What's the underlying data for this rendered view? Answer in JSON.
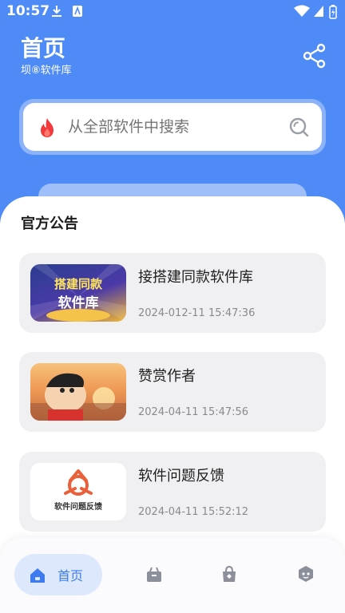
{
  "status_bar": {
    "time": "10:57"
  },
  "header": {
    "title": "首页",
    "subtitle": "坝⑧软件库"
  },
  "search": {
    "placeholder": "从全部软件中搜索"
  },
  "announcements": {
    "title": "官方公告",
    "items": [
      {
        "title": "接搭建同款软件库",
        "time": "2024-012-11 15:47:36",
        "thumb_text_1": "搭建同款",
        "thumb_text_2": "软件库"
      },
      {
        "title": "赞赏作者",
        "time": "2024-04-11 15:47:56"
      },
      {
        "title": "软件问题反馈",
        "time": "2024-04-11 15:52:12",
        "thumb_text": "软件问题反馈"
      }
    ]
  },
  "bottom_nav": {
    "home_label": "首页"
  },
  "colors": {
    "primary": "#4f8bf6",
    "nav_active_bg": "#dde8fd",
    "nav_active_text": "#3f7bef",
    "card_bg": "#f0f0f2"
  }
}
